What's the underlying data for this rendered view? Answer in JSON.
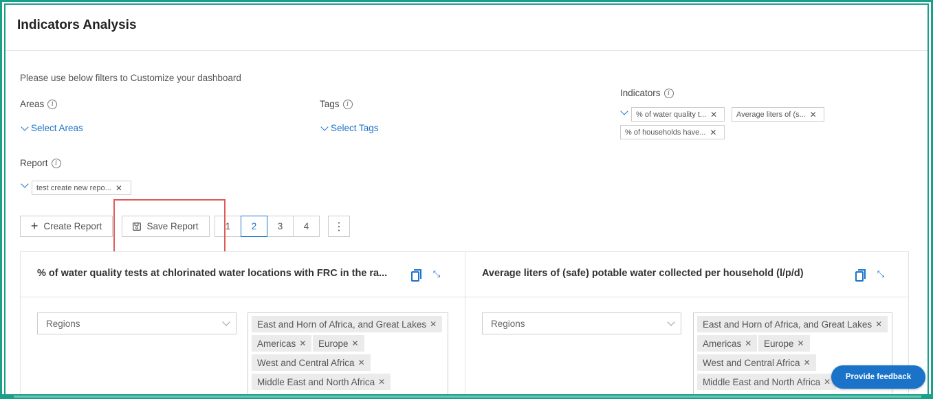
{
  "page": {
    "title": "Indicators Analysis",
    "intro": "Please use below filters to Customize your dashboard"
  },
  "filters": {
    "areas": {
      "label": "Areas",
      "select_text": "Select Areas"
    },
    "tags": {
      "label": "Tags",
      "select_text": "Select Tags"
    },
    "indicators": {
      "label": "Indicators",
      "chips": [
        "% of water quality t...",
        "Average liters of (s...",
        "% of households have..."
      ]
    },
    "report": {
      "label": "Report",
      "chip": "test create new repo..."
    }
  },
  "toolbar": {
    "create_label": "Create Report",
    "save_label": "Save Report",
    "pages": [
      "1",
      "2",
      "3",
      "4"
    ],
    "active_page": "2",
    "more_label": "⋮"
  },
  "panels": [
    {
      "title": "% of water quality tests at chlorinated water locations with FRC in the ra...",
      "dropdown": "Regions",
      "regions": [
        "East and Horn of Africa, and Great Lakes",
        "Americas",
        "Europe",
        "West and Central Africa",
        "Middle East and North Africa"
      ]
    },
    {
      "title": "Average liters of (safe) potable water collected per household (l/p/d)",
      "dropdown": "Regions",
      "regions": [
        "East and Horn of Africa, and Great Lakes",
        "Americas",
        "Europe",
        "West and Central Africa",
        "Middle East and North Africa"
      ]
    }
  ],
  "feedback": {
    "label": "Provide feedback"
  },
  "colors": {
    "accent": "#1a73c8",
    "frame": "#1aa08a",
    "highlight": "#e05a5a"
  },
  "icons": {
    "info": "info-icon",
    "chevron": "chevron-down-icon",
    "close": "close-icon",
    "plus": "plus-icon",
    "save": "save-icon",
    "copy": "copy-icon",
    "shrink": "collapse-icon",
    "more": "more-vertical-icon"
  }
}
